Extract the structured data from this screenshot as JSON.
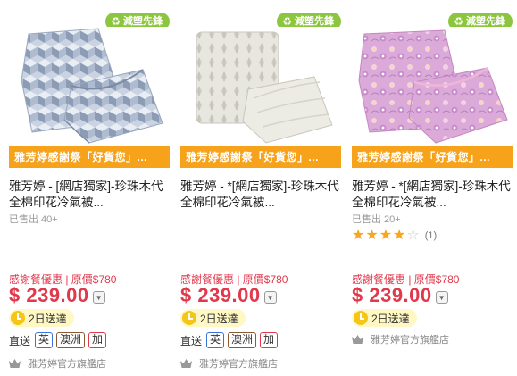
{
  "products": [
    {
      "eco_badge": "減塑先鋒",
      "promo_banner": "雅芳婷感謝祭「好貨您」...",
      "title": "雅芳婷 - [網店獨家]-珍珠木代全棉印花冷氣被...",
      "sold": "已售出 40+",
      "promo_text": "感謝餐優惠 | 原價$780",
      "price": "$ 239.00",
      "delivery": "2日送達",
      "shipping_label": "直送",
      "shipping_tags": [
        "英",
        "澳洲",
        "加"
      ],
      "store": "雅芳婷官方旗艦店",
      "image_pattern": "blue-geometric"
    },
    {
      "eco_badge": "減塑先鋒",
      "promo_banner": "雅芳婷感謝祭「好貨您」...",
      "title": "雅芳婷 - *[網店獨家]-珍珠木代全棉印花冷氣被...",
      "promo_text": "感謝餐優惠 | 原價$780",
      "price": "$ 239.00",
      "delivery": "2日送達",
      "shipping_label": "直送",
      "shipping_tags": [
        "英",
        "澳洲",
        "加"
      ],
      "store": "雅芳婷官方旗艦店",
      "image_pattern": "grey-leaves"
    },
    {
      "eco_badge": "減塑先鋒",
      "promo_banner": "雅芳婷感謝祭「好貨您」...",
      "title": "雅芳婷 - *[網店獨家]-珍珠木代全棉印花冷氣被...",
      "sold": "已售出 20+",
      "rating": {
        "value": 4,
        "max": 5,
        "count": "(1)"
      },
      "promo_text": "感謝餐優惠 | 原價$780",
      "price": "$ 239.00",
      "delivery": "2日送達",
      "store": "雅芳婷官方旗艦店",
      "image_pattern": "pink-floral"
    }
  ],
  "colors": {
    "eco_green": "#8cc63f",
    "promo_orange": "#f7a21b",
    "price_red": "#e0394c",
    "star_gold": "#f5a623",
    "delivery_yellow": "#fff8c5"
  }
}
